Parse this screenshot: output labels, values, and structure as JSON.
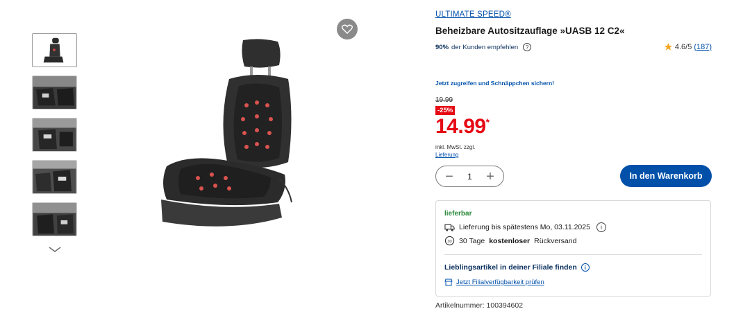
{
  "product": {
    "brand": "ULTIMATE SPEED®",
    "title": "Beheizbare Autositzauflage »UASB 12 C2«",
    "recommend_pct": "90%",
    "recommend_text": "der Kunden empfehlen",
    "rating_value": "4.6/5",
    "rating_count": "(187)",
    "promo": "Jetzt zugreifen und Schnäppchen sichern!",
    "old_price": "19.99",
    "discount": "-25%",
    "price_main": "14.99",
    "price_star": "*",
    "vat": "inkl. MwSt. zzgl.",
    "delivery_link": "Lieferung",
    "quantity": "1",
    "minus": "−",
    "plus": "+",
    "cart_button": "In den Warenkorb",
    "article_number": "Artikelnummer: 100394602"
  },
  "availability": {
    "status": "lieferbar",
    "delivery_by": "Lieferung bis spätestens Mo, 03.11.2025",
    "return_prefix": "30 Tage",
    "return_bold": "kostenloser",
    "return_suffix": "Rückversand",
    "store_title": "Lieblingsartikel in deiner Filiale finden",
    "store_link": "Jetzt Filialverfügbarkeit prüfen"
  },
  "icons": {
    "wishlist": "heart-icon",
    "star": "star-icon",
    "info": "info-icon",
    "delivery": "delivery-truck-icon",
    "return": "return-30-icon",
    "store": "store-icon",
    "scroll": "chevron-down-icon"
  },
  "colors": {
    "brand_blue": "#0050aa",
    "price_red": "#e60a14",
    "available_green": "#2e8b3d",
    "star_gold": "#f5a623"
  }
}
